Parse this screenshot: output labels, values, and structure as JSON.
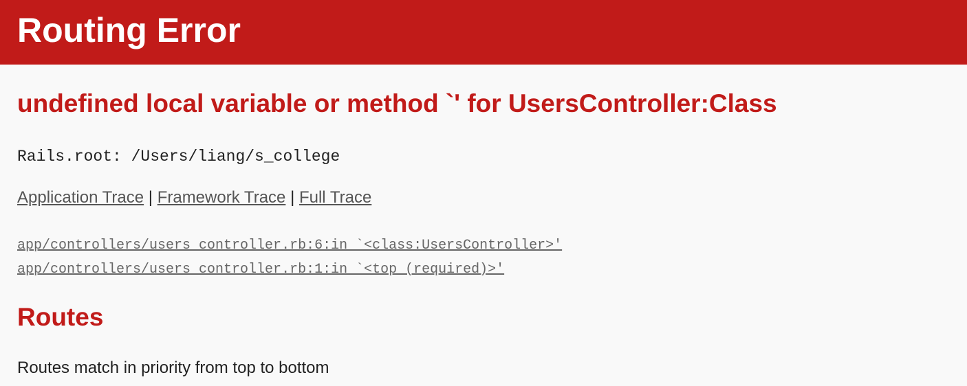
{
  "header": {
    "title": "Routing Error"
  },
  "error": {
    "message": "undefined local variable or method `' for UsersController:Class"
  },
  "rails_root": {
    "text": "Rails.root: /Users/liang/s_college"
  },
  "trace_links": {
    "application": "Application Trace",
    "framework": "Framework Trace",
    "full": "Full Trace",
    "separator": "|"
  },
  "trace_lines": [
    "app/controllers/users_controller.rb:6:in `<class:UsersController>'",
    "app/controllers/users_controller.rb:1:in `<top (required)>'"
  ],
  "routes": {
    "title": "Routes",
    "description": "Routes match in priority from top to bottom"
  },
  "colors": {
    "header_bg": "#c11b19",
    "header_text": "#ffffff",
    "accent_red": "#c11b19",
    "page_bg": "#f9f9f9",
    "link_gray": "#555555"
  }
}
